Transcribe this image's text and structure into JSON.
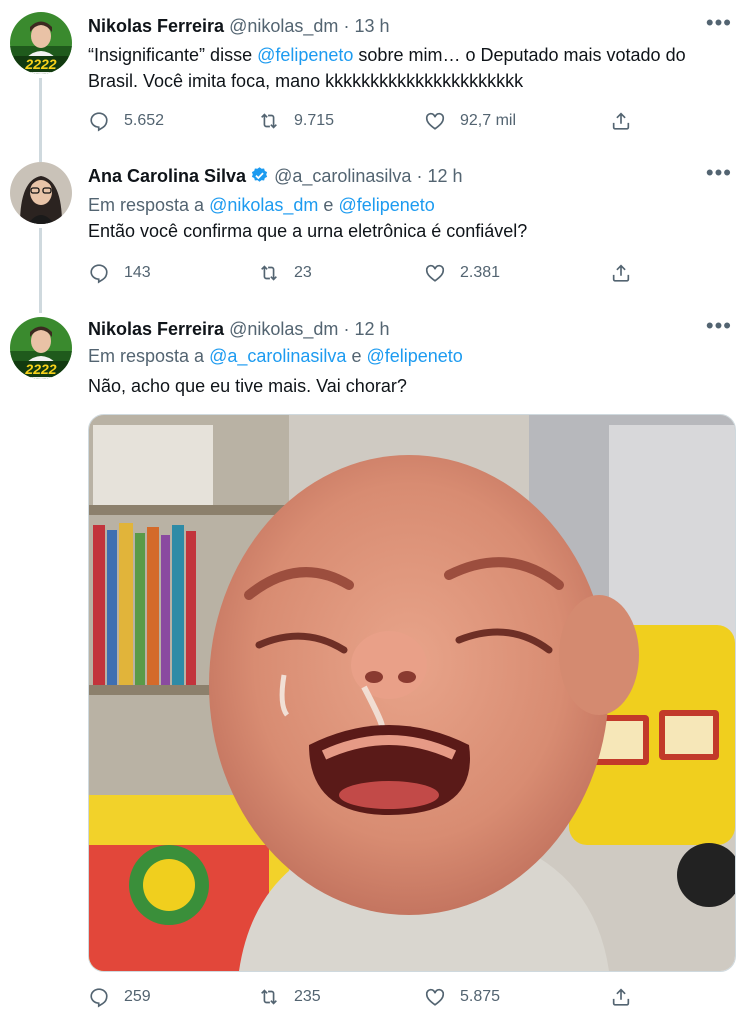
{
  "tweets": [
    {
      "name": "Nikolas Ferreira",
      "handle": "@nikolas_dm",
      "dot": "·",
      "time": "13 h",
      "avatar_badge": "2222",
      "text_part1": "“Insignificante” disse ",
      "text_mention": "@felipeneto",
      "text_part2": " sobre mim… o Deputado mais votado do Brasil. Você imita foca, mano kkkkkkkkkkkkkkkkkkkkkk",
      "replies": "5.652",
      "retweets": "9.715",
      "likes": "92,7 mil"
    },
    {
      "name": "Ana Carolina Silva",
      "handle": "@a_carolinasilva",
      "dot": "·",
      "time": "12 h",
      "reply_prefix": "Em resposta a",
      "reply_to_1": "@nikolas_dm",
      "reply_joiner": "e",
      "reply_to_2": "@felipeneto",
      "text": "Então você confirma que a urna eletrônica é confiável?",
      "replies": "143",
      "retweets": "23",
      "likes": "2.381"
    },
    {
      "name": "Nikolas Ferreira",
      "handle": "@nikolas_dm",
      "dot": "·",
      "time": "12 h",
      "avatar_badge": "2222",
      "reply_prefix": "Em resposta a",
      "reply_to_1": "@a_carolinasilva",
      "reply_joiner": "e",
      "reply_to_2": "@felipeneto",
      "text": "Não, acho que eu tive mais. Vai chorar?",
      "replies": "259",
      "retweets": "235",
      "likes": "5.875"
    }
  ],
  "colors": {
    "accent": "#1d9bf0",
    "muted": "#536471",
    "line": "#cfd9de"
  },
  "icons": [
    "more-icon",
    "reply-icon",
    "retweet-icon",
    "like-icon",
    "share-icon",
    "verified-icon"
  ]
}
